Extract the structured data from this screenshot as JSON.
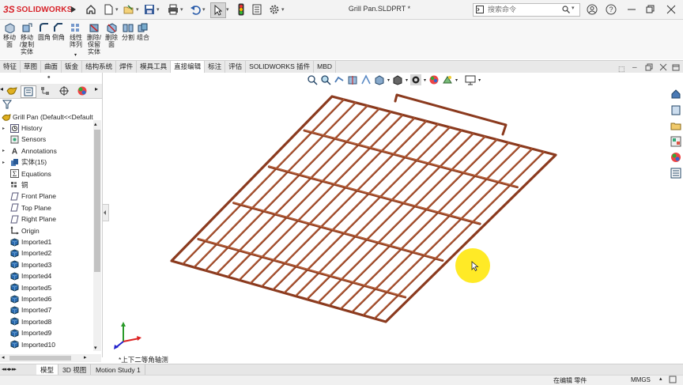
{
  "app": {
    "logo_ds": "3S",
    "logo_name": "SOLIDWORKS",
    "doc_title": "Grill Pan.SLDPRT *",
    "search_placeholder": "搜索命令"
  },
  "commands": [
    {
      "label": "移动\n面"
    },
    {
      "label": "移动\n/复制\n实体"
    },
    {
      "label": "圆角"
    },
    {
      "label": "倒角"
    },
    {
      "label": "线性\n阵列"
    },
    {
      "label": "删除/\n保留\n实体"
    },
    {
      "label": "删除\n面"
    },
    {
      "label": "分割"
    },
    {
      "label": "组合"
    }
  ],
  "tabs": [
    {
      "label": "特征",
      "active": false
    },
    {
      "label": "草图",
      "active": false
    },
    {
      "label": "曲面",
      "active": false
    },
    {
      "label": "钣金",
      "active": false
    },
    {
      "label": "结构系统",
      "active": false
    },
    {
      "label": "焊件",
      "active": false
    },
    {
      "label": "模具工具",
      "active": false
    },
    {
      "label": "直接编辑",
      "active": true
    },
    {
      "label": "标注",
      "active": false
    },
    {
      "label": "评估",
      "active": false
    },
    {
      "label": "SOLIDWORKS 插件",
      "active": false
    },
    {
      "label": "MBD",
      "active": false
    }
  ],
  "tree": {
    "root": "Grill Pan  (Default<<Default>",
    "items": [
      {
        "label": "History",
        "expand": true,
        "icon": "history-icon"
      },
      {
        "label": "Sensors",
        "expand": false,
        "icon": "sensor-icon"
      },
      {
        "label": "Annotations",
        "expand": true,
        "icon": "annotation-icon"
      },
      {
        "label": "实体(15)",
        "expand": true,
        "icon": "solid-bodies-icon"
      },
      {
        "label": "Equations",
        "expand": false,
        "icon": "equation-icon"
      },
      {
        "label": "铜",
        "expand": false,
        "icon": "material-icon"
      },
      {
        "label": "Front Plane",
        "expand": false,
        "icon": "plane-icon"
      },
      {
        "label": "Top Plane",
        "expand": false,
        "icon": "plane-icon"
      },
      {
        "label": "Right Plane",
        "expand": false,
        "icon": "plane-icon"
      },
      {
        "label": "Origin",
        "expand": false,
        "icon": "origin-icon"
      },
      {
        "label": "Imported1",
        "expand": false,
        "icon": "body-icon"
      },
      {
        "label": "Imported2",
        "expand": false,
        "icon": "body-icon"
      },
      {
        "label": "Imported3",
        "expand": false,
        "icon": "body-icon"
      },
      {
        "label": "Imported4",
        "expand": false,
        "icon": "body-icon"
      },
      {
        "label": "Imported5",
        "expand": false,
        "icon": "body-icon"
      },
      {
        "label": "Imported6",
        "expand": false,
        "icon": "body-icon"
      },
      {
        "label": "Imported7",
        "expand": false,
        "icon": "body-icon"
      },
      {
        "label": "Imported8",
        "expand": false,
        "icon": "body-icon"
      },
      {
        "label": "Imported9",
        "expand": false,
        "icon": "body-icon"
      },
      {
        "label": "Imported10",
        "expand": false,
        "icon": "body-icon"
      }
    ]
  },
  "viewport": {
    "view_label": "*上下二等角轴测"
  },
  "bottom_tabs": [
    {
      "label": "模型",
      "active": true
    },
    {
      "label": "3D 视图",
      "active": false
    },
    {
      "label": "Motion Study 1",
      "active": false
    }
  ],
  "status": {
    "mode": "在编辑 零件",
    "units": "MMGS"
  },
  "colors": {
    "brand": "#d8232a",
    "wire": "#8b3a1e",
    "accent_blue": "#1f6fb5",
    "highlight": "#ffe600"
  }
}
